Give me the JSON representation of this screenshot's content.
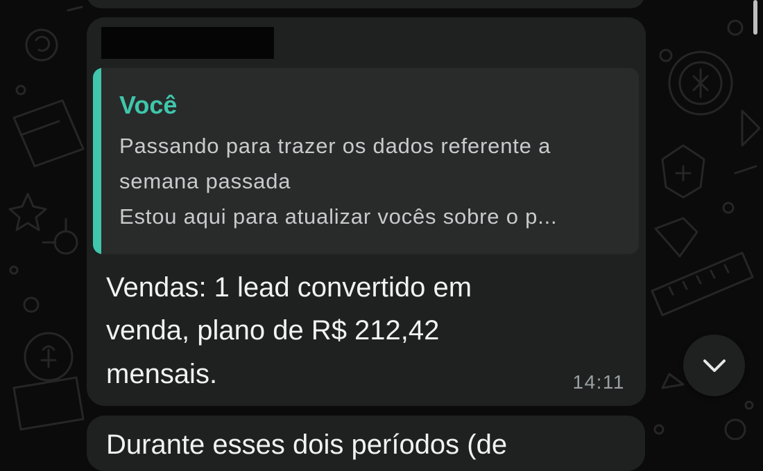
{
  "quoted": {
    "author": "Você",
    "lines": [
      "Passando para trazer os dados referente a",
      "semana passada",
      "Estou aqui para atualizar vocês sobre o p..."
    ]
  },
  "message": {
    "lines": [
      "Vendas: 1 lead convertido em",
      "venda, plano de R$ 212,42",
      "mensais."
    ],
    "time": "14:11"
  },
  "next_message": {
    "text": "Durante esses dois períodos (de"
  },
  "colors": {
    "accent": "#3fc6ac",
    "bubble": "#1f2121",
    "quote_bg": "#292b2b",
    "background": "#0b0b0b"
  },
  "icons": {
    "scroll_down": "chevron-down-icon"
  }
}
